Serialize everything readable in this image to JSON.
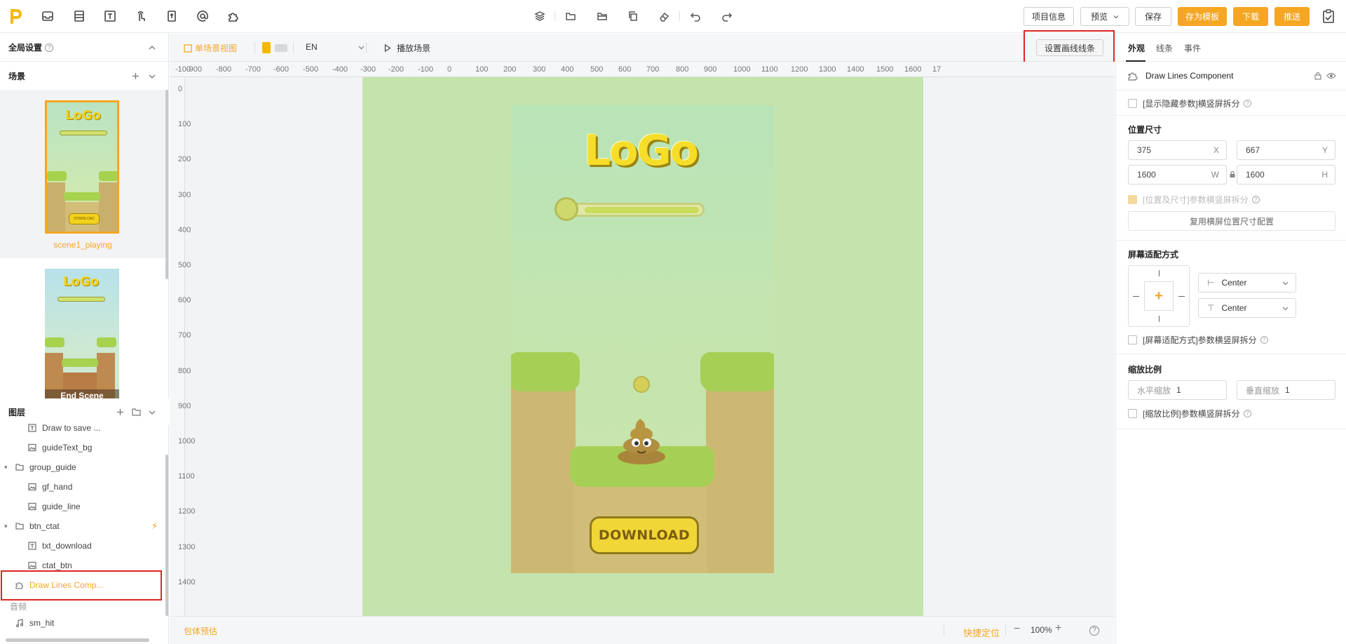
{
  "toolbar": {
    "buttons": {
      "project_info": "项目信息",
      "preview": "预览",
      "save": "保存",
      "save_template": "存为模板",
      "download": "下载",
      "push": "推送"
    }
  },
  "left": {
    "global_settings": "全局设置",
    "scenes_title": "场景",
    "scenes": [
      {
        "name": "scene1_playing",
        "thumb_logo": "LoGo",
        "thumb_button": "DOWNLOAD"
      },
      {
        "name": "End Scene",
        "thumb_logo": "LoGo"
      }
    ],
    "layers_title": "图层",
    "layers": [
      {
        "label": "Draw to save ...",
        "icon": "text-icon",
        "level": 2
      },
      {
        "label": "guideText_bg",
        "icon": "image-icon",
        "level": 2
      },
      {
        "label": "group_guide",
        "icon": "folder-icon",
        "level": 1
      },
      {
        "label": "gf_hand",
        "icon": "image-icon",
        "level": 2
      },
      {
        "label": "guide_line",
        "icon": "image-icon",
        "level": 2
      },
      {
        "label": "btn_ctat",
        "icon": "folder-icon",
        "level": 1
      },
      {
        "label": "txt_download",
        "icon": "text-icon",
        "level": 2
      },
      {
        "label": "ctat_btn",
        "icon": "image-icon",
        "level": 2
      },
      {
        "label": "Draw Lines Comp...",
        "icon": "component-icon",
        "level": 1,
        "active": true
      }
    ],
    "audio_title": "音频",
    "audio_items": [
      {
        "label": "sm_hit"
      }
    ]
  },
  "canvas": {
    "toolbar": {
      "single_view": "单场景视图",
      "language": "EN",
      "play_scene": "播放场景",
      "set_lines": "设置画线线条"
    },
    "ruler_h": [
      "-100",
      "-900",
      "-800",
      "-700",
      "-600",
      "-500",
      "-400",
      "-300",
      "-200",
      "-100",
      "0",
      "100",
      "200",
      "300",
      "400",
      "500",
      "600",
      "700",
      "800",
      "900",
      "1000",
      "1100",
      "1200",
      "1300",
      "1400",
      "1500",
      "1600",
      "17"
    ],
    "ruler_v": [
      "0",
      "100",
      "200",
      "300",
      "400",
      "500",
      "600",
      "700",
      "800",
      "900",
      "1000",
      "1100",
      "1200",
      "1300",
      "1400"
    ],
    "game": {
      "logo": "LoGo",
      "download": "DOWNLOAD"
    },
    "status": {
      "pack_size": "包体预估",
      "quick_locate": "快捷定位",
      "zoom": "100%"
    }
  },
  "right": {
    "tabs": [
      "外观",
      "线条",
      "事件"
    ],
    "component_name": "Draw Lines Component",
    "show_hidden": "[显示隐藏参数]横竖屏拆分",
    "position_size_title": "位置尺寸",
    "x_value": "375",
    "x_label": "X",
    "y_value": "667",
    "y_label": "Y",
    "w_value": "1600",
    "w_label": "W",
    "h_value": "1600",
    "h_label": "H",
    "pos_split": "[位置及尺寸]参数横竖屏拆分",
    "reuse_landscape": "复用横屏位置尺寸配置",
    "fit_title": "屏幕适配方式",
    "fit_h": "Center",
    "fit_v": "Center",
    "fit_split": "[屏幕适配方式]参数横竖屏拆分",
    "scale_title": "缩放比例",
    "scale_h_label": "水平缩放",
    "scale_h": "1",
    "scale_v_label": "垂直缩放",
    "scale_v": "1",
    "scale_split": "[缩放比例]参数横竖屏拆分"
  }
}
